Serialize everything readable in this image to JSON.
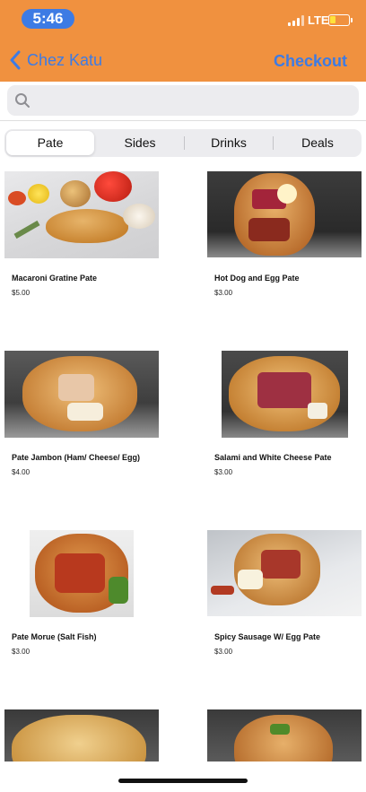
{
  "status": {
    "time": "5:46",
    "network": "LTE"
  },
  "nav": {
    "back_label": "Chez Katu",
    "action_label": "Checkout"
  },
  "search": {
    "placeholder": ""
  },
  "tabs": [
    {
      "label": "Pate",
      "active": true
    },
    {
      "label": "Sides",
      "active": false
    },
    {
      "label": "Drinks",
      "active": false
    },
    {
      "label": "Deals",
      "active": false
    }
  ],
  "items": [
    {
      "name": "Macaroni Gratine Pate",
      "price": "$5.00"
    },
    {
      "name": "Hot Dog and Egg Pate",
      "price": "$3.00"
    },
    {
      "name": "Pate Jambon (Ham/ Cheese/ Egg)",
      "price": "$4.00"
    },
    {
      "name": "Salami and White Cheese Pate",
      "price": "$3.00"
    },
    {
      "name": "Pate Morue (Salt Fish)",
      "price": "$3.00"
    },
    {
      "name": "Spicy Sausage W/ Egg Pate",
      "price": "$3.00"
    }
  ],
  "colors": {
    "brand": "#f0913f",
    "link": "#3d7be4",
    "battery": "#ffe23a"
  }
}
